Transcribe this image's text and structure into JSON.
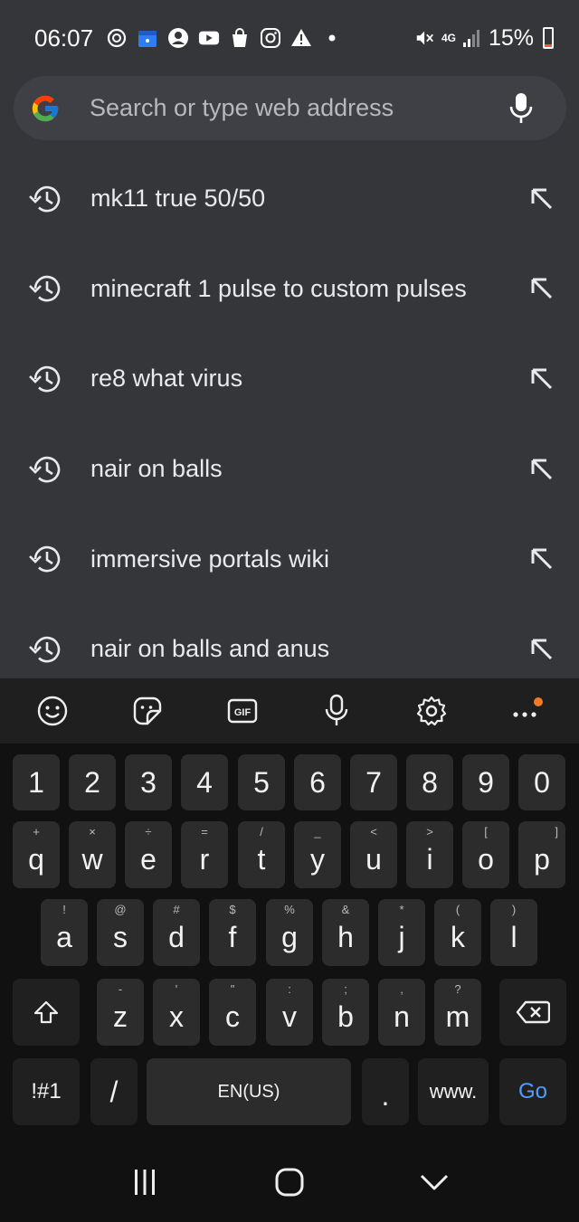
{
  "status": {
    "time": "06:07",
    "network": "4G",
    "battery": "15%",
    "battery_level": 0.15,
    "battery_color": "#e56040",
    "notification_icons": [
      "ring-icon",
      "calendar-icon",
      "face-icon",
      "youtube-icon",
      "shopping-bag-icon",
      "instagram-icon",
      "warning-icon",
      "dot-icon"
    ],
    "system_icons": [
      "mute-icon",
      "signal-icon",
      "battery-icon"
    ]
  },
  "search": {
    "placeholder": "Search or type web address",
    "logo": "google-g-icon",
    "voice_icon": "microphone-icon"
  },
  "suggestions": [
    {
      "text": "mk11 true 50/50"
    },
    {
      "text": "minecraft 1 pulse to custom pulses"
    },
    {
      "text": "re8 what virus"
    },
    {
      "text": "nair on balls"
    },
    {
      "text": "immersive portals wiki"
    },
    {
      "text": "nair on balls and anus"
    }
  ],
  "keyboard_toolbar": {
    "items": [
      "emoji-icon",
      "sticker-icon",
      "gif-icon",
      "voice-input-icon",
      "settings-icon",
      "more-icon"
    ],
    "gif_label": "GIF",
    "accent": "#f07a28"
  },
  "keyboard": {
    "number_row": [
      "1",
      "2",
      "3",
      "4",
      "5",
      "6",
      "7",
      "8",
      "9",
      "0"
    ],
    "row1": [
      {
        "key": "q",
        "sub": "+"
      },
      {
        "key": "w",
        "sub": "×"
      },
      {
        "key": "e",
        "sub": "÷"
      },
      {
        "key": "r",
        "sub": "="
      },
      {
        "key": "t",
        "sub": "/"
      },
      {
        "key": "y",
        "sub": "_"
      },
      {
        "key": "u",
        "sub": "<"
      },
      {
        "key": "i",
        "sub": ">"
      },
      {
        "key": "o",
        "sub": "["
      },
      {
        "key": "p",
        "sub": "]"
      }
    ],
    "row2": [
      {
        "key": "a",
        "sub": "!"
      },
      {
        "key": "s",
        "sub": "@"
      },
      {
        "key": "d",
        "sub": "#"
      },
      {
        "key": "f",
        "sub": "$"
      },
      {
        "key": "g",
        "sub": "%"
      },
      {
        "key": "h",
        "sub": "&"
      },
      {
        "key": "j",
        "sub": "*"
      },
      {
        "key": "k",
        "sub": "("
      },
      {
        "key": "l",
        "sub": ")"
      }
    ],
    "row3": [
      {
        "key": "z",
        "sub": "-"
      },
      {
        "key": "x",
        "sub": "'"
      },
      {
        "key": "c",
        "sub": "\""
      },
      {
        "key": "v",
        "sub": ":"
      },
      {
        "key": "b",
        "sub": ";"
      },
      {
        "key": "n",
        "sub": ","
      },
      {
        "key": "m",
        "sub": "?"
      }
    ],
    "symbols_label": "!#1",
    "slash_label": "/",
    "space_label": "EN(US)",
    "period_label": ".",
    "www_label": "www.",
    "go_label": "Go",
    "go_color": "#4e9dff"
  },
  "nav": {
    "items": [
      "recent-apps-icon",
      "home-icon",
      "back-icon"
    ]
  }
}
